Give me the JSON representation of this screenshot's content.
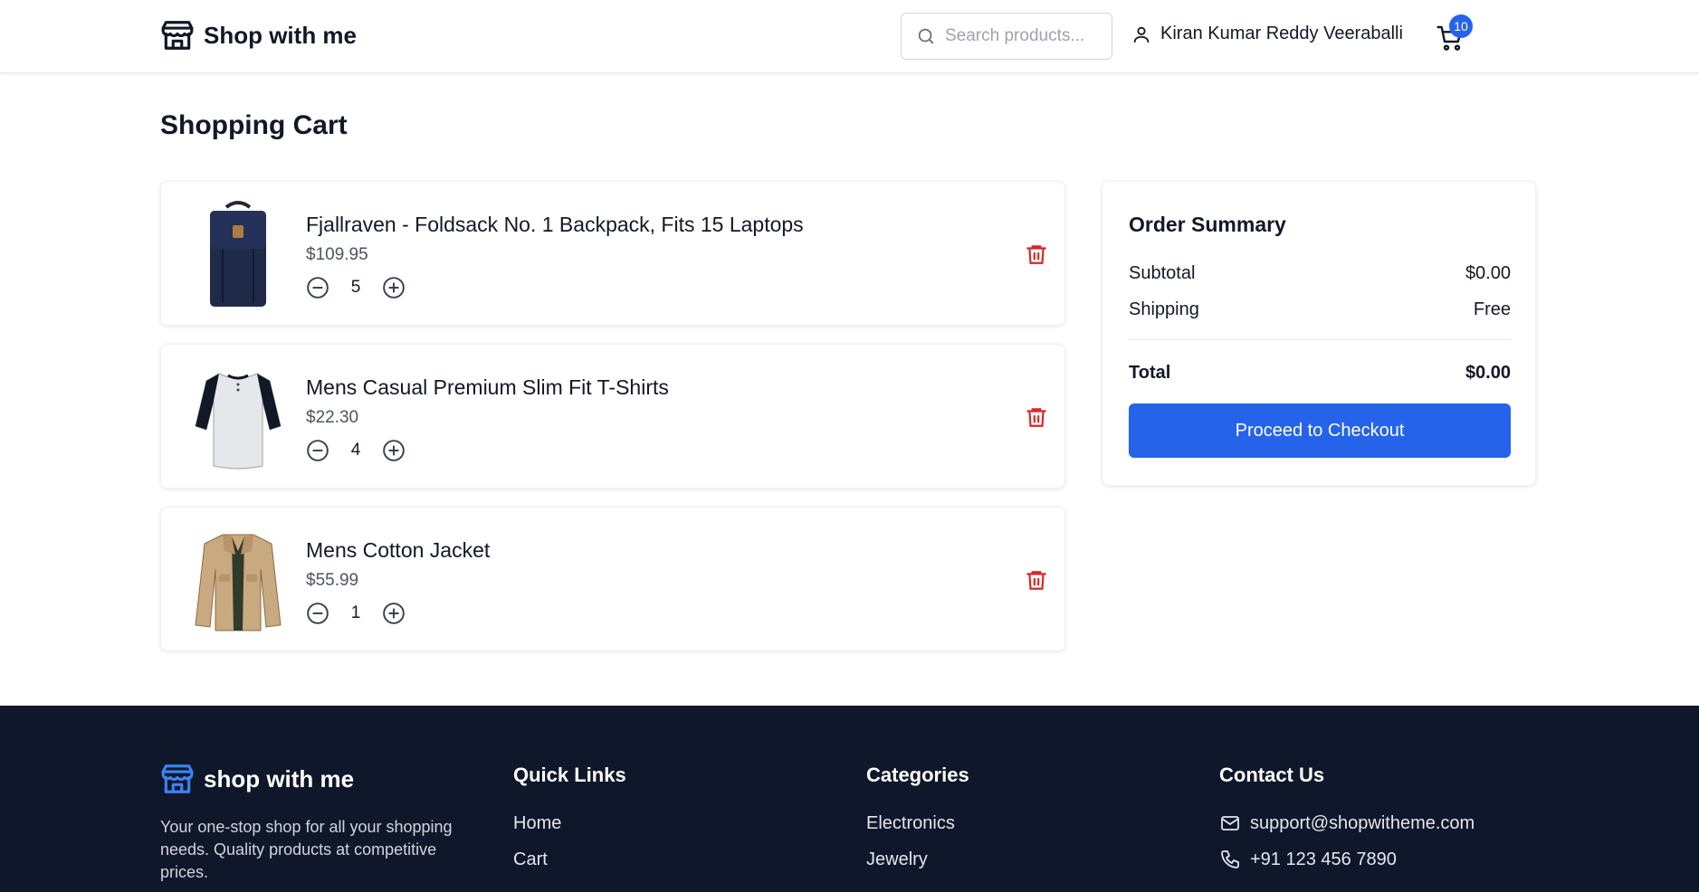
{
  "header": {
    "brand": "Shop with me",
    "search_placeholder": "Search products...",
    "user_name": "Kiran Kumar Reddy Veeraballi",
    "cart_count": "10"
  },
  "page_title": "Shopping Cart",
  "cart": {
    "items": [
      {
        "name": "Fjallraven - Foldsack No. 1 Backpack, Fits 15 Laptops",
        "price": "$109.95",
        "quantity": "5",
        "image": "backpack-image"
      },
      {
        "name": "Mens Casual Premium Slim Fit T-Shirts",
        "price": "$22.30",
        "quantity": "4",
        "image": "tshirt-image"
      },
      {
        "name": "Mens Cotton Jacket",
        "price": "$55.99",
        "quantity": "1",
        "image": "jacket-image"
      }
    ]
  },
  "summary": {
    "title": "Order Summary",
    "subtotal_label": "Subtotal",
    "subtotal_value": "$0.00",
    "shipping_label": "Shipping",
    "shipping_value": "Free",
    "total_label": "Total",
    "total_value": "$0.00",
    "checkout_label": "Proceed to Checkout"
  },
  "footer": {
    "brand": "shop with me",
    "description": "Your one-stop shop for all your shopping needs. Quality products at competitive prices.",
    "quick_links": {
      "title": "Quick Links",
      "links": [
        "Home",
        "Cart"
      ]
    },
    "categories": {
      "title": "Categories",
      "links": [
        "Electronics",
        "Jewelry"
      ]
    },
    "contact": {
      "title": "Contact Us",
      "email": "support@shopwitheme.com",
      "phone": "+91 123 456 7890"
    }
  },
  "colors": {
    "accent": "#2563eb",
    "danger": "#dc2626",
    "footer_bg": "#0f172a"
  }
}
